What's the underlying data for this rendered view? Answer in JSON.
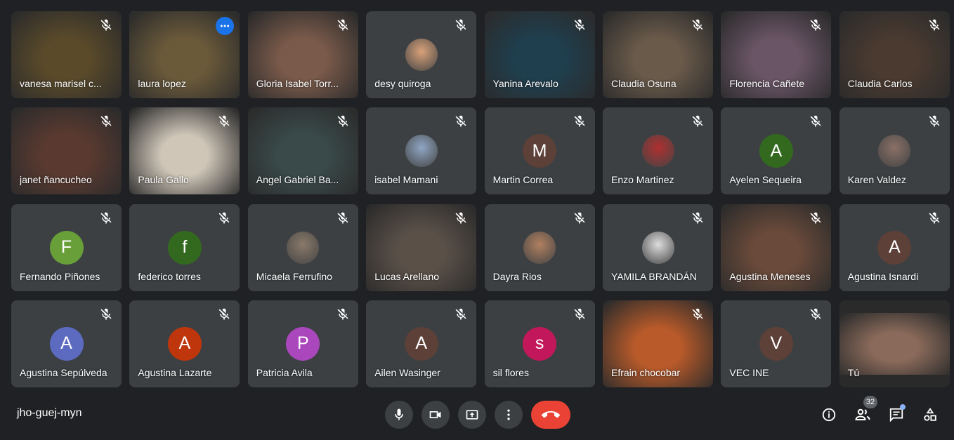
{
  "meeting": {
    "code": "jho-guej-myn"
  },
  "participants": [
    {
      "name": "vanesa marisel c...",
      "type": "video",
      "tone": "#5a4a2a"
    },
    {
      "name": "laura lopez",
      "type": "video",
      "tone": "#6b5a3a",
      "active": true
    },
    {
      "name": "Gloria Isabel Torr...",
      "type": "video",
      "tone": "#7a5a4a"
    },
    {
      "name": "desy quiroga",
      "type": "photo",
      "tone": "#d9a27a"
    },
    {
      "name": "Yanina Arevalo",
      "type": "video",
      "tone": "#1f3f4f"
    },
    {
      "name": "Claudia Osuna",
      "type": "video",
      "tone": "#6a5a4a"
    },
    {
      "name": "Florencia Cañete",
      "type": "video",
      "tone": "#6a5566"
    },
    {
      "name": "Claudia Carlos",
      "type": "video",
      "tone": "#4a3a30"
    },
    {
      "name": "janet ñancucheo",
      "type": "video",
      "tone": "#5a3a30"
    },
    {
      "name": "Paula Gallo",
      "type": "video",
      "tone": "#cfc6b8"
    },
    {
      "name": "Angel Gabriel Ba...",
      "type": "video",
      "tone": "#3a4a4a"
    },
    {
      "name": "isabel Mamani",
      "type": "photo",
      "tone": "#8fa6c4"
    },
    {
      "name": "Martin Correa",
      "type": "initial",
      "initial": "M",
      "color": "#5d4037"
    },
    {
      "name": "Enzo Martinez",
      "type": "photo",
      "tone": "#b03030"
    },
    {
      "name": "Ayelen Sequeira",
      "type": "initial",
      "initial": "A",
      "color": "#33691e"
    },
    {
      "name": "Karen Valdez",
      "type": "photo",
      "tone": "#8a7066"
    },
    {
      "name": "Fernando Piñones",
      "type": "initial",
      "initial": "F",
      "color": "#689f38"
    },
    {
      "name": "federico torres",
      "type": "initial",
      "initial": "f",
      "color": "#33691e"
    },
    {
      "name": "Micaela Ferrufino",
      "type": "photo",
      "tone": "#8a7a6a"
    },
    {
      "name": "Lucas Arellano",
      "type": "video",
      "tone": "#5a5048"
    },
    {
      "name": "Dayra Rios",
      "type": "photo",
      "tone": "#b08060"
    },
    {
      "name": "YAMILA BRANDÁN",
      "type": "photo",
      "tone": "#dddddd"
    },
    {
      "name": "Agustina Meneses",
      "type": "video",
      "tone": "#6a4a3a"
    },
    {
      "name": "Agustina Isnardi",
      "type": "initial",
      "initial": "A",
      "color": "#5d4037"
    },
    {
      "name": "Agustina Sepúlveda",
      "type": "initial",
      "initial": "A",
      "color": "#5c6bc0"
    },
    {
      "name": "Agustina Lazarte",
      "type": "initial",
      "initial": "A",
      "color": "#bf360c"
    },
    {
      "name": "Patricia Avila",
      "type": "initial",
      "initial": "P",
      "color": "#ab47bc"
    },
    {
      "name": "Ailen Wasinger",
      "type": "initial",
      "initial": "A",
      "color": "#5d4037"
    },
    {
      "name": "sil flores",
      "type": "initial",
      "initial": "s",
      "color": "#c2185b"
    },
    {
      "name": "Efrain chocobar",
      "type": "video",
      "tone": "#b85a2a"
    },
    {
      "name": "VEC INE",
      "type": "initial",
      "initial": "V",
      "color": "#5d4037"
    },
    {
      "name": "Tú",
      "type": "self",
      "tone": "#8a6a5a"
    }
  ],
  "participant_count": "32",
  "colors": {
    "hangup": "#ea4335",
    "background": "#202124",
    "tile": "#3c4043",
    "accent": "#8ab4f8"
  }
}
